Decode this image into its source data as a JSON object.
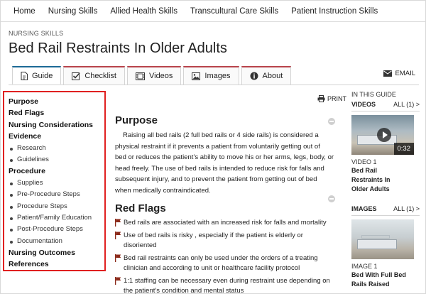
{
  "topnav": [
    "Home",
    "Nursing Skills",
    "Allied Health Skills",
    "Transcultural Care Skills",
    "Patient Instruction Skills"
  ],
  "section_label": "NURSING SKILLS",
  "title": "Bed Rail Restraints In Older Adults",
  "tabs": [
    {
      "label": "Guide",
      "icon": "document-icon"
    },
    {
      "label": "Checklist",
      "icon": "checkbox-icon"
    },
    {
      "label": "Videos",
      "icon": "film-icon"
    },
    {
      "label": "Images",
      "icon": "image-icon"
    },
    {
      "label": "About",
      "icon": "info-icon"
    }
  ],
  "email_label": "EMAIL",
  "guide_nav": [
    {
      "label": "Purpose",
      "level": 1
    },
    {
      "label": "Red Flags",
      "level": 1
    },
    {
      "label": "Nursing Considerations",
      "level": 1
    },
    {
      "label": "Evidence",
      "level": 1
    },
    {
      "label": "Research",
      "level": 2
    },
    {
      "label": "Guidelines",
      "level": 2
    },
    {
      "label": "Procedure",
      "level": 1
    },
    {
      "label": "Supplies",
      "level": 2
    },
    {
      "label": "Pre-Procedure Steps",
      "level": 2
    },
    {
      "label": "Procedure Steps",
      "level": 2
    },
    {
      "label": "Patient/Family Education",
      "level": 2
    },
    {
      "label": "Post-Procedure Steps",
      "level": 2
    },
    {
      "label": "Documentation",
      "level": 2
    },
    {
      "label": "Nursing Outcomes",
      "level": 1
    },
    {
      "label": "References",
      "level": 1
    }
  ],
  "print_label": "PRINT",
  "purpose": {
    "heading": "Purpose",
    "lines": [
      "Raising all bed rails (2 full bed rails or 4 side rails) is considered a",
      "physical restraint if it prevents a patient from voluntarily getting out of",
      "bed or reduces the patient’s ability to move his or her arms, legs, body, or",
      "head freely. The use of bed rails is intended to reduce risk for falls and",
      "subsequent injury, and to prevent the patient from getting out of bed",
      "when medically contraindicated."
    ]
  },
  "red_flags": {
    "heading": "Red Flags",
    "items": [
      [
        "Bed rails are associated with an increased risk for falls and mortality"
      ],
      [
        "Use of bed rails is risky , especially if the patient is elderly or",
        "disoriented"
      ],
      [
        "Bed rail restraints can only be used under the orders of a treating",
        "clinician and according to unit or healthcare facility protocol"
      ],
      [
        "1:1 staffing can be necessary even during restraint use depending on",
        "the patient’s condition and mental status"
      ]
    ]
  },
  "rail": {
    "title": "IN THIS GUIDE",
    "videos": {
      "label": "VIDEOS",
      "all": "ALL (1) >",
      "duration": "0:32",
      "caption": "VIDEO 1",
      "name": [
        "Bed Rail",
        "Restraints In",
        "Older Adults"
      ]
    },
    "images": {
      "label": "IMAGES",
      "all": "ALL (1) >",
      "caption": "IMAGE 1",
      "name": [
        "Bed With Full Bed",
        "Rails Raised"
      ]
    }
  },
  "colors": {
    "highlight_border": "#e02020",
    "tab_accent": "#b8434b",
    "flag": "#8b2a1a"
  }
}
